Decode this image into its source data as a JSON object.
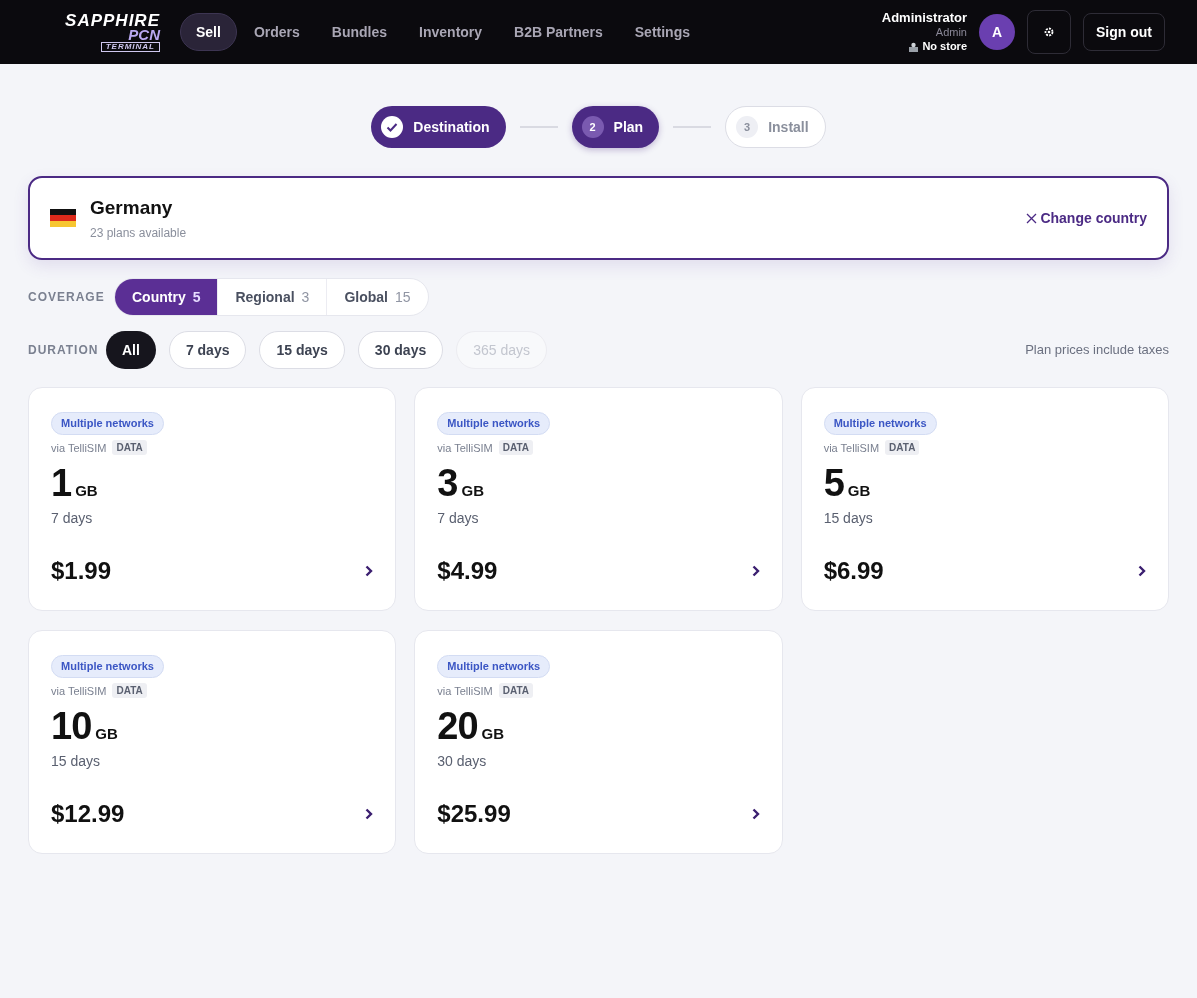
{
  "logo": {
    "line_1": "SAPPHIRE",
    "line_2": "PCN",
    "line_3": "TERMINAL"
  },
  "nav": [
    {
      "label": "Sell",
      "selected": true
    },
    {
      "label": "Orders",
      "selected": false
    },
    {
      "label": "Bundles",
      "selected": false
    },
    {
      "label": "Inventory",
      "selected": false
    },
    {
      "label": "B2B Partners",
      "selected": false
    },
    {
      "label": "Settings",
      "selected": false
    }
  ],
  "user": {
    "name": "Administrator",
    "role": "Admin",
    "store": "No store",
    "avatar": "A"
  },
  "sign_out": "Sign out",
  "steps": [
    {
      "label": "Destination",
      "completed": true,
      "selected": false
    },
    {
      "number": "2",
      "label": "Plan",
      "completed": false,
      "selected": true
    },
    {
      "number": "3",
      "label": "Install",
      "completed": false,
      "selected": false
    }
  ],
  "destination": {
    "country": "Germany",
    "subtitle": "23 plans available",
    "change": "Change country"
  },
  "coverage": {
    "label": "COVERAGE",
    "options": [
      {
        "label": "Country",
        "count": "5",
        "selected": true
      },
      {
        "label": "Regional",
        "count": "3",
        "selected": false
      },
      {
        "label": "Global",
        "count": "15",
        "selected": false
      }
    ]
  },
  "duration": {
    "label": "DURATION",
    "options": [
      {
        "label": "All",
        "selected": true,
        "disabled": false
      },
      {
        "label": "7 days",
        "selected": false,
        "disabled": false
      },
      {
        "label": "15 days",
        "selected": false,
        "disabled": false
      },
      {
        "label": "30 days",
        "selected": false,
        "disabled": false
      },
      {
        "label": "365 days",
        "selected": false,
        "disabled": true
      }
    ]
  },
  "tax_note": "Plan prices include taxes",
  "plans": [
    {
      "badge": "Multiple networks",
      "provider": "via TelliSIM",
      "type": "DATA",
      "amount": "1",
      "unit": "GB",
      "days": "7 days",
      "price": "$1.99"
    },
    {
      "badge": "Multiple networks",
      "provider": "via TelliSIM",
      "type": "DATA",
      "amount": "3",
      "unit": "GB",
      "days": "7 days",
      "price": "$4.99"
    },
    {
      "badge": "Multiple networks",
      "provider": "via TelliSIM",
      "type": "DATA",
      "amount": "5",
      "unit": "GB",
      "days": "15 days",
      "price": "$6.99"
    },
    {
      "badge": "Multiple networks",
      "provider": "via TelliSIM",
      "type": "DATA",
      "amount": "10",
      "unit": "GB",
      "days": "15 days",
      "price": "$12.99"
    },
    {
      "badge": "Multiple networks",
      "provider": "via TelliSIM",
      "type": "DATA",
      "amount": "20",
      "unit": "GB",
      "days": "30 days",
      "price": "$25.99"
    }
  ]
}
